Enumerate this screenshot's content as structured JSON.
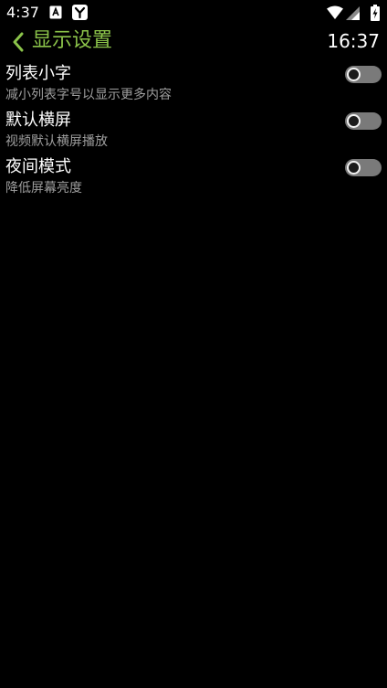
{
  "status_bar": {
    "time": "4:37",
    "notifications": [
      "a-box-icon",
      "y-box-icon"
    ],
    "system_icons": [
      "wifi-icon",
      "cellular-signal-icon",
      "battery-charging-icon"
    ]
  },
  "toolbar": {
    "title": "显示设置",
    "clock": "16:37"
  },
  "settings": [
    {
      "title": "列表小字",
      "subtitle": "减小列表字号以显示更多内容",
      "enabled": false
    },
    {
      "title": "默认横屏",
      "subtitle": "视频默认横屏播放",
      "enabled": false
    },
    {
      "title": "夜间模式",
      "subtitle": "降低屏幕亮度",
      "enabled": false
    }
  ],
  "colors": {
    "accent": "#8bc34a",
    "background": "#000000",
    "subtitle": "#9e9e9e",
    "switch_track_off": "#7a7a7a"
  }
}
